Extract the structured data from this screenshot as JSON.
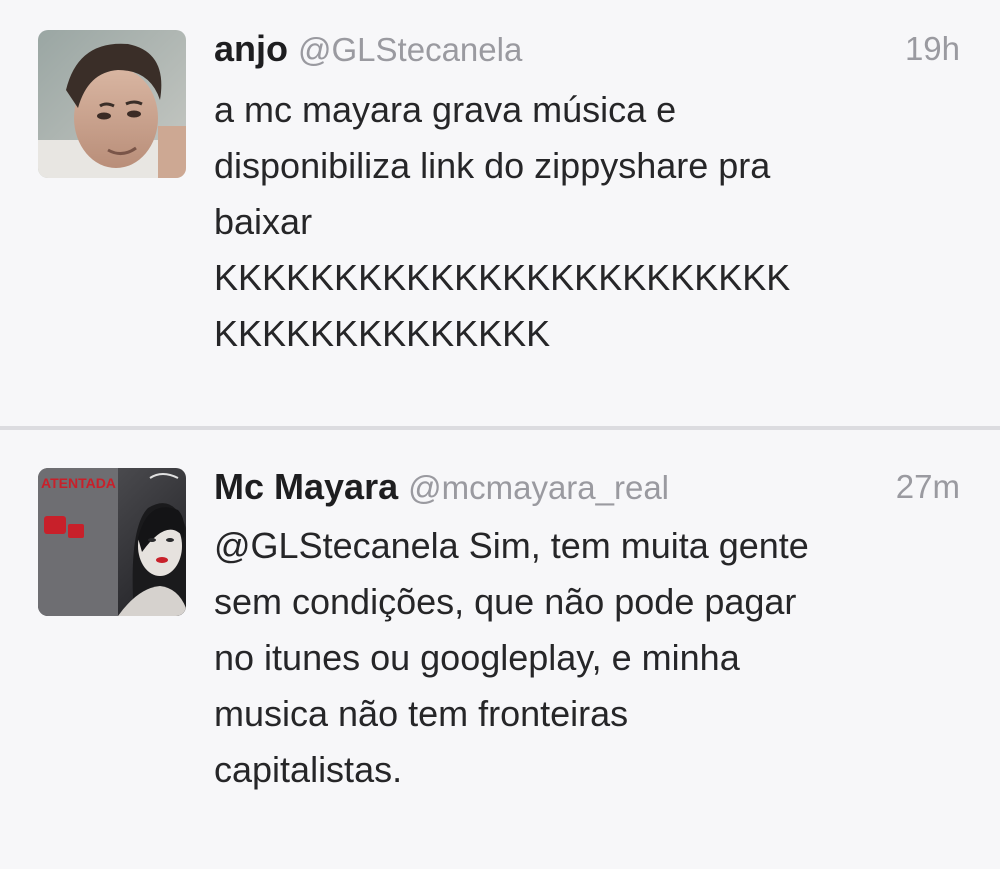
{
  "tweets": [
    {
      "name": "anjo",
      "handle": "@GLStecanela",
      "time": "19h",
      "text": "a mc mayara grava música e\ndisponibiliza link do zippyshare pra\nbaixar\nKKKKKKKKKKKKKKKKKKKKKKKK\nKKKKKKKKKKKKKK",
      "avatar_icon": "avatar-photo-young-man"
    },
    {
      "name": "Mc Mayara",
      "handle": "@mcmayara_real",
      "time": "27m",
      "text": "@GLStecanela Sim, tem muita gente\nsem condições, que não pode pagar\nno itunes ou googleplay, e minha\nmusica não tem fronteiras\ncapitalistas.",
      "avatar_icon": "avatar-photo-woman-poster",
      "avatar_text": "ATENTADA"
    }
  ],
  "colors": {
    "background": "#f7f7f9",
    "divider": "#dcdce0",
    "meta_text": "#9a9aa0",
    "body_text": "#262628",
    "accent_red": "#c8202a"
  }
}
